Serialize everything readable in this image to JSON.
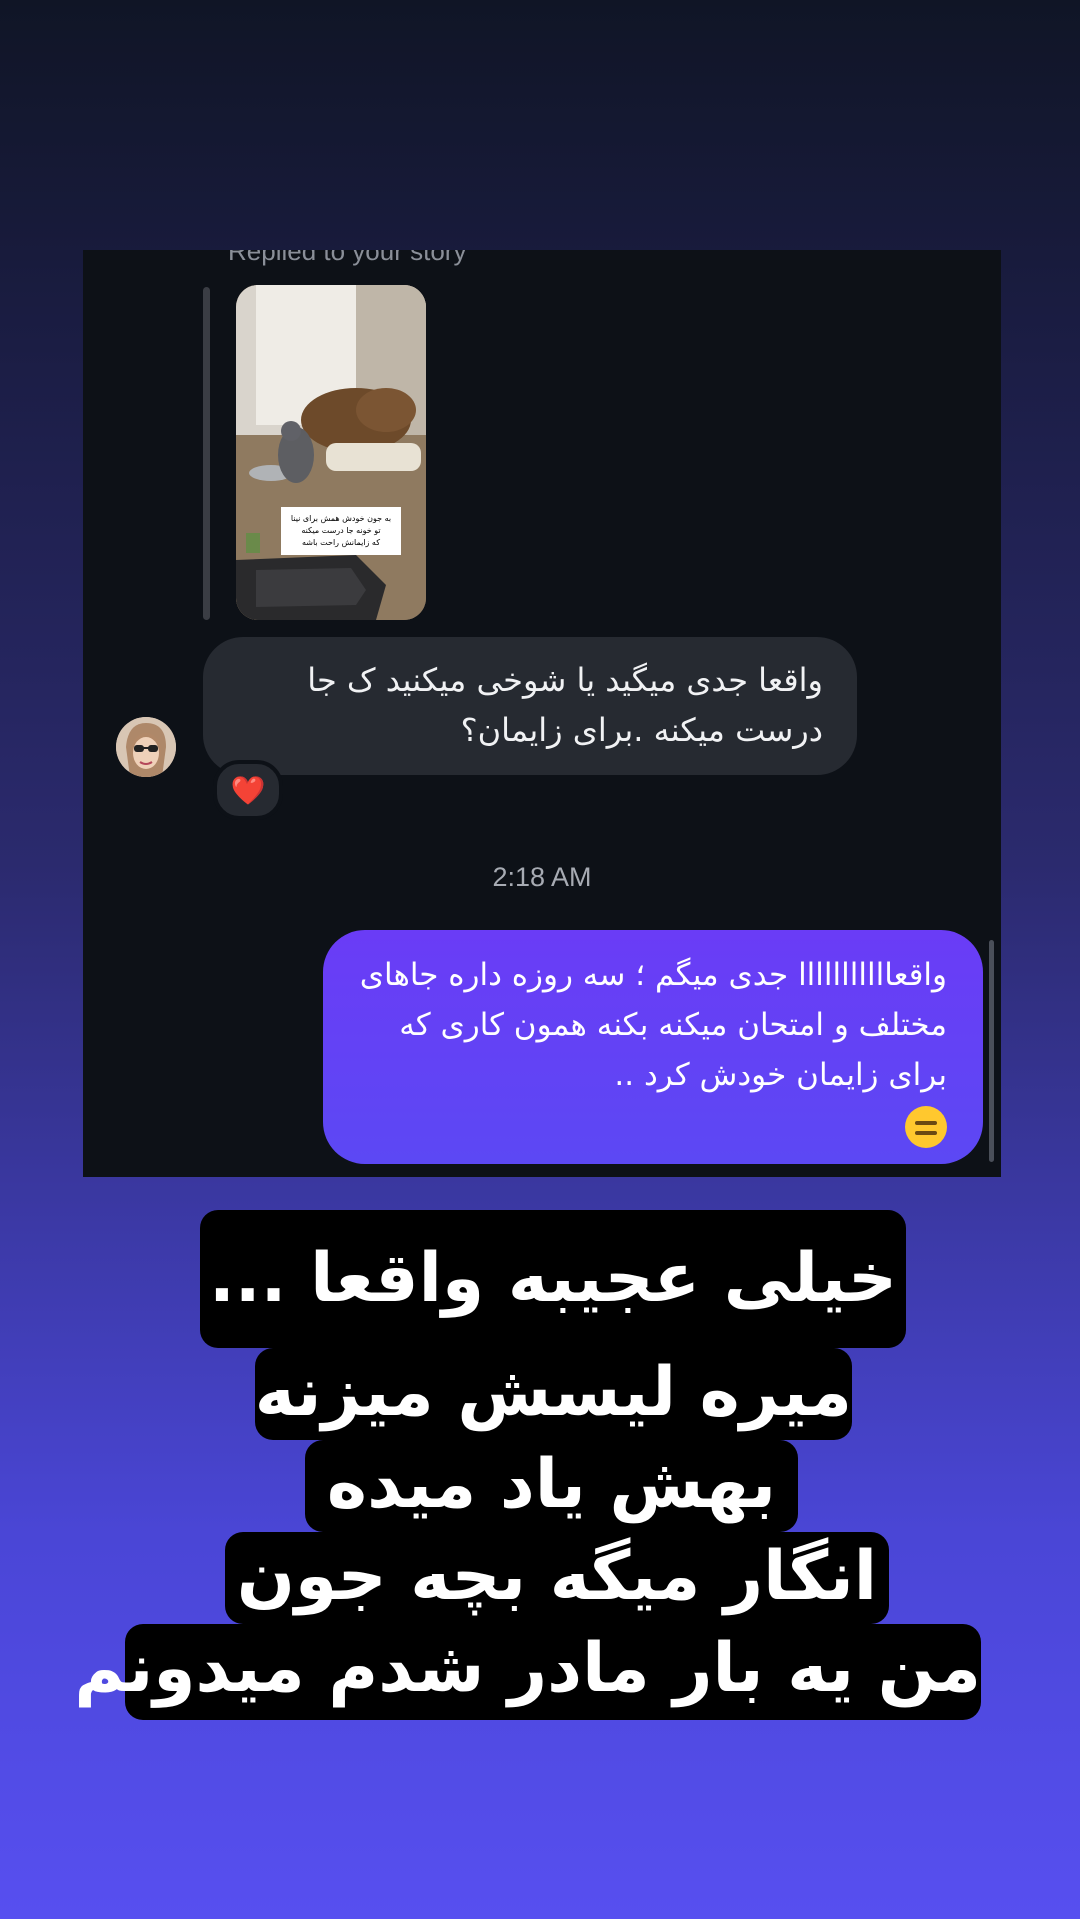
{
  "chat": {
    "replied_label": "Replied to your story",
    "story_sticker_text": "به جون خودش همش برای نینا تو خونه جا درست میکنه که زایمانش راحت باشه 😔",
    "incoming_message": "واقعا جدی میگید یا شوخی میکنید ک جا درست میکنه .برای زایمان؟",
    "reaction": "❤️",
    "timestamp": "2:18 AM",
    "outgoing_message": "واقعااااااااااا جدی میگم ؛ سه روزه داره جاهای مختلف و امتحان میکنه بکنه همون کاری که برای زایمان خودش کرد ..",
    "outgoing_emoji": "face-with-horizontal-eyes-emoji"
  },
  "caption": {
    "lines": [
      "خیلی عجیبه واقعا ...",
      "میره لیسش میزنه",
      "بهش یاد میده",
      "انگار میگه بچه جون",
      "من یه بار مادر شدم میدونم"
    ]
  },
  "colors": {
    "chat_background": "#0d1117",
    "incoming_bubble": "#262a31",
    "outgoing_bubble": "#5c48f4",
    "caption_background": "#000000",
    "caption_text": "#ffffff"
  }
}
